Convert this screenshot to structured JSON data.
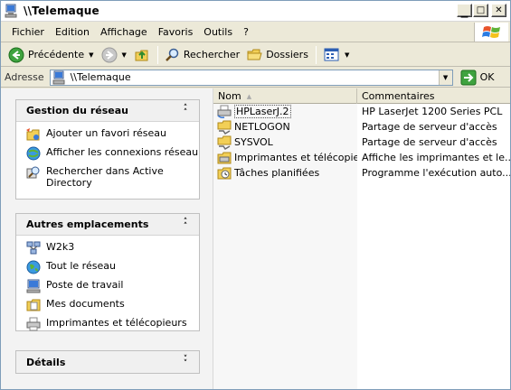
{
  "window": {
    "title": "\\\\Telemaque"
  },
  "menubar": {
    "items": [
      "Fichier",
      "Edition",
      "Affichage",
      "Favoris",
      "Outils",
      "?"
    ]
  },
  "toolbar": {
    "back_label": "Précédente",
    "search_label": "Rechercher",
    "folders_label": "Dossiers"
  },
  "address": {
    "label": "Adresse",
    "value": "\\\\Telemaque",
    "go_label": "OK"
  },
  "taskpane": {
    "network_tasks": {
      "title": "Gestion du réseau",
      "items": [
        {
          "label": "Ajouter un favori réseau",
          "icon": "add-network-place-icon"
        },
        {
          "label": "Afficher les connexions réseau",
          "icon": "network-connections-icon"
        },
        {
          "label": "Rechercher dans Active Directory",
          "icon": "search-directory-icon"
        }
      ]
    },
    "other_places": {
      "title": "Autres emplacements",
      "items": [
        {
          "label": "W2k3",
          "icon": "domain-icon"
        },
        {
          "label": "Tout le réseau",
          "icon": "entire-network-icon"
        },
        {
          "label": "Poste de travail",
          "icon": "my-computer-icon"
        },
        {
          "label": "Mes documents",
          "icon": "my-documents-icon"
        },
        {
          "label": "Imprimantes et télécopieurs",
          "icon": "printers-icon"
        }
      ]
    },
    "details": {
      "title": "Détails"
    }
  },
  "files": {
    "columns": {
      "name": "Nom",
      "comments": "Commentaires"
    },
    "rows": [
      {
        "name": "HPLaserJ.2",
        "comment": "HP LaserJet 1200 Series PCL",
        "icon": "printer-icon"
      },
      {
        "name": "NETLOGON",
        "comment": "Partage de serveur d'accès",
        "icon": "shared-folder-icon"
      },
      {
        "name": "SYSVOL",
        "comment": "Partage de serveur d'accès",
        "icon": "shared-folder-icon"
      },
      {
        "name": "Imprimantes et télécopieurs",
        "comment": "Affiche les imprimantes et le...",
        "icon": "printers-folder-icon"
      },
      {
        "name": "Tâches planifiées",
        "comment": "Programme l'exécution auto...",
        "icon": "scheduled-tasks-icon"
      }
    ]
  },
  "colors": {
    "accent": "#215dc6",
    "link": "#000000",
    "title": "#000000"
  }
}
